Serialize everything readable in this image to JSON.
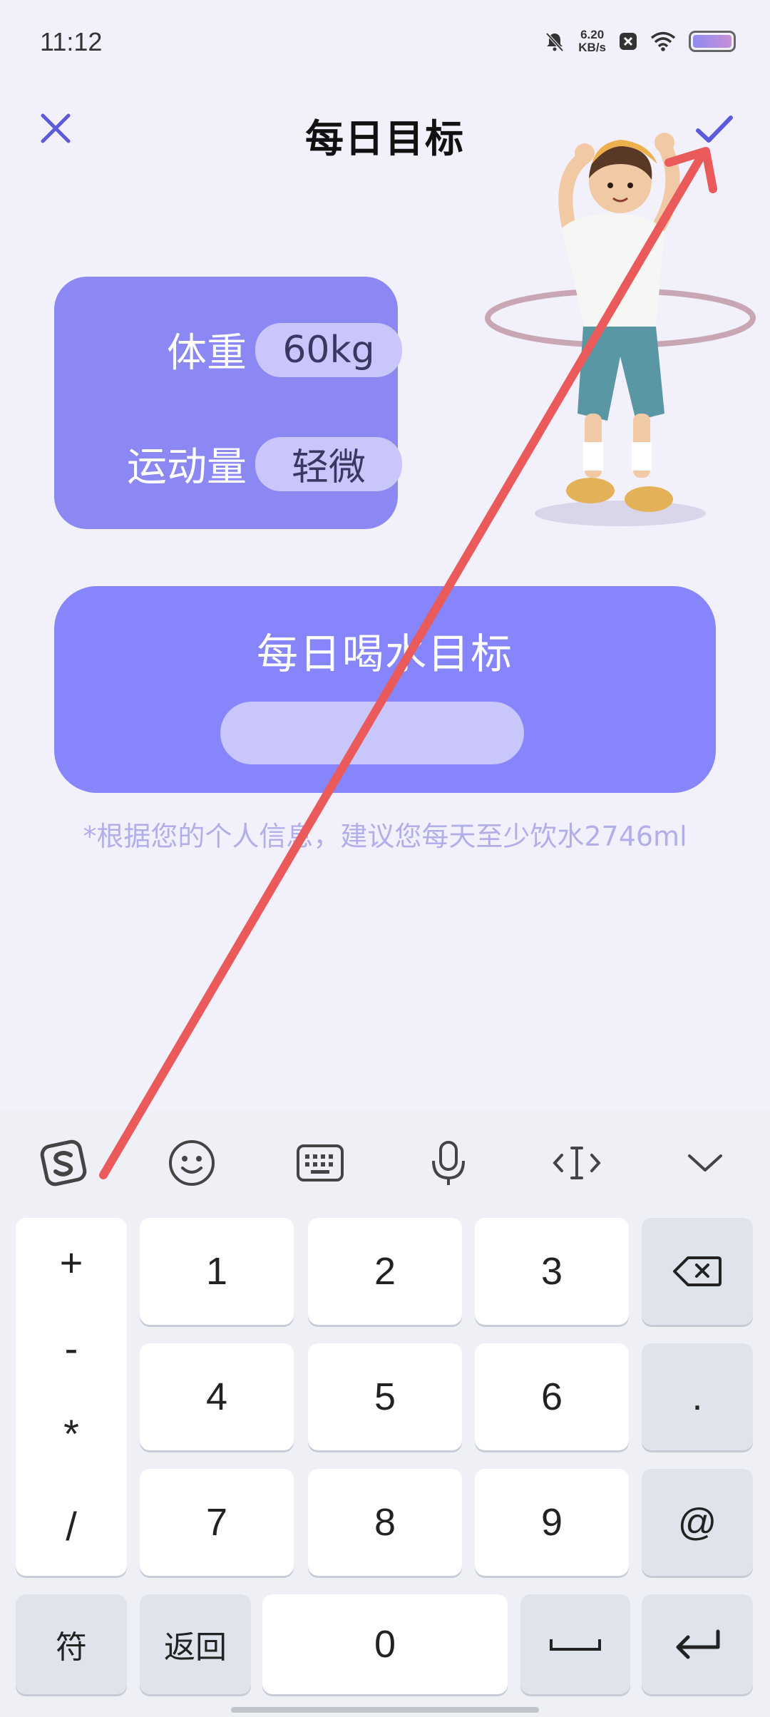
{
  "status_bar": {
    "time": "11:12",
    "net_speed_value": "6.20",
    "net_speed_unit": "KB/s"
  },
  "header": {
    "title": "每日目标"
  },
  "info_card": {
    "weight_label": "体重",
    "weight_value": "60kg",
    "activity_label": "运动量",
    "activity_value": "轻微"
  },
  "water_card": {
    "title": "每日喝水目标",
    "input_value": "",
    "hint": "*根据您的个人信息，建议您每天至少饮水2746ml"
  },
  "keyboard": {
    "toolbar_icons": [
      "sogou-logo-icon",
      "emoji-icon",
      "keyboard-icon",
      "microphone-icon",
      "cursor-icon",
      "collapse-chevron-icon"
    ],
    "ops": [
      "+",
      "-",
      "*",
      "/"
    ],
    "digits": [
      "1",
      "2",
      "3",
      "4",
      "5",
      "6",
      "7",
      "8",
      "9",
      "0"
    ],
    "dot": ".",
    "at": "@",
    "symbol_key": "符",
    "back_key": "返回"
  },
  "colors": {
    "accent": "#5d5bdc",
    "card": "#8b87f3",
    "pill": "#c8c6fb",
    "annotation_arrow": "#ea5a5a"
  }
}
